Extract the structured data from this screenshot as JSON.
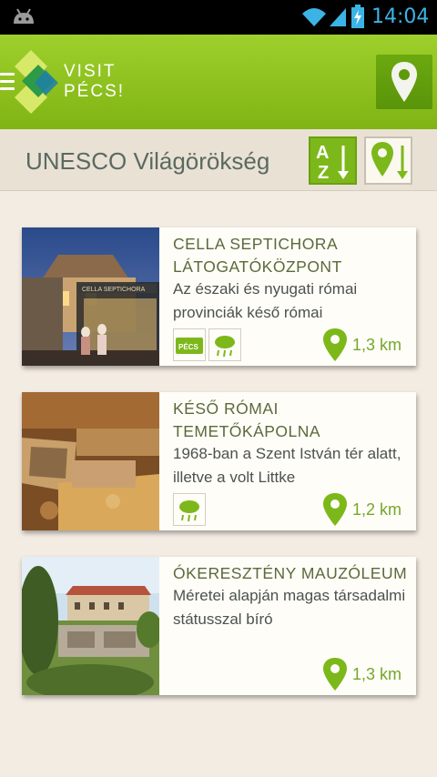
{
  "status_bar": {
    "time": "14:04"
  },
  "action_bar": {
    "logo_line1": "VISIT",
    "logo_line2": "PÉCS!"
  },
  "header": {
    "title": "UNESCO Világörökség"
  },
  "sort": {
    "az_label": "A\nZ"
  },
  "cards": [
    {
      "title": "CELLA SEPTICHORA LÁTOGATÓKÖZPONT",
      "description": "Az északi és nyugati római provinciák késő római",
      "badges": [
        "pecs-card-icon",
        "weather-icon"
      ],
      "pecs_badge_text": "PÉCS",
      "photo_sign": "CELLA SEPTICHORA",
      "distance": "1,3 km"
    },
    {
      "title": "KÉSŐ RÓMAI TEMETŐKÁPOLNA",
      "description": "1968-ban a Szent István tér alatt, illetve a volt Littke",
      "badges": [
        "weather-icon"
      ],
      "distance": "1,2 km"
    },
    {
      "title": "ÓKERESZTÉNY MAUZÓLEUM",
      "description": "Méretei alapján magas társadalmi státusszal bíró",
      "badges": [],
      "distance": "1,3 km"
    }
  ],
  "colors": {
    "accent": "#7db81a",
    "header_green": "#8cc21f",
    "background": "#f3ece3"
  }
}
